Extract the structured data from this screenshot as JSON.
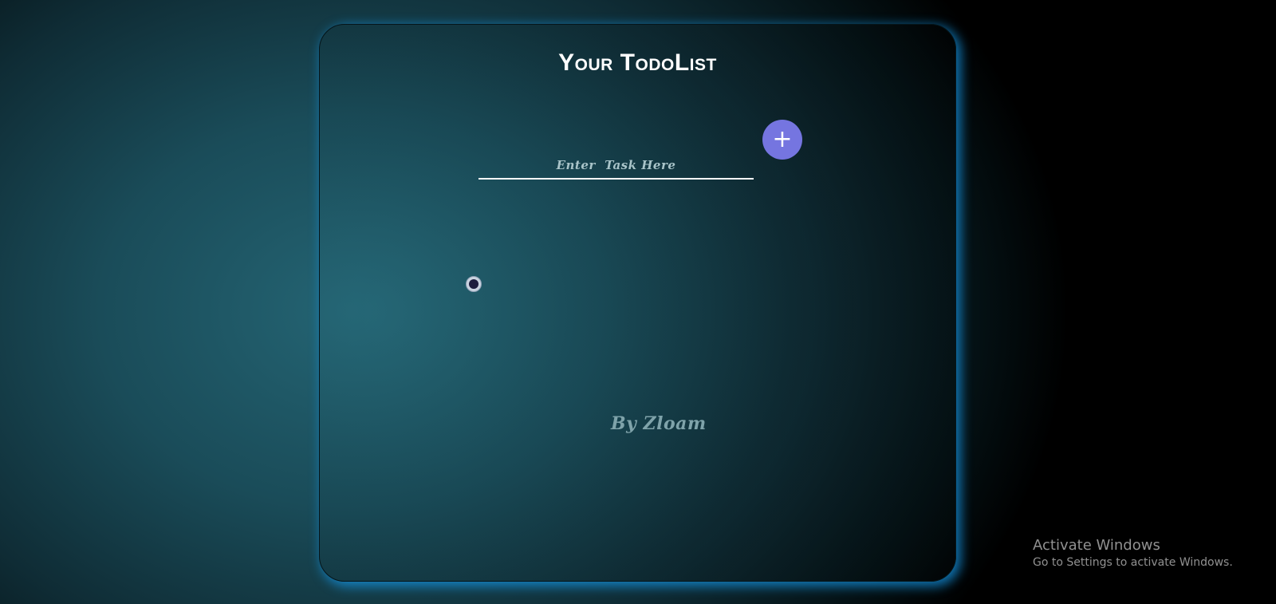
{
  "app": {
    "title": "Your TodoList",
    "input_placeholder": "Enter  Task Here",
    "add_button_symbol": "+",
    "credit": "By Zloam",
    "accent_color": "#7575e0",
    "glow_color": "#1496e6"
  },
  "task_toggle": {
    "checked": true
  },
  "os_overlay": {
    "activate_title": "Activate Windows",
    "activate_subtitle": "Go to Settings to activate Windows."
  }
}
